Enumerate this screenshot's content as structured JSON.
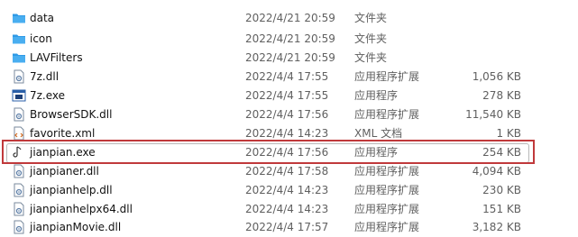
{
  "files": [
    {
      "icon": "folder-icon",
      "name": "data",
      "date": "2022/4/21 20:59",
      "type": "文件夹",
      "size": ""
    },
    {
      "icon": "folder-icon",
      "name": "icon",
      "date": "2022/4/21 20:59",
      "type": "文件夹",
      "size": ""
    },
    {
      "icon": "folder-icon",
      "name": "LAVFilters",
      "date": "2022/4/21 20:59",
      "type": "文件夹",
      "size": ""
    },
    {
      "icon": "dll-icon",
      "name": "7z.dll",
      "date": "2022/4/4 17:55",
      "type": "应用程序扩展",
      "size": "1,056 KB"
    },
    {
      "icon": "exe-icon",
      "name": "7z.exe",
      "date": "2022/4/4 17:55",
      "type": "应用程序",
      "size": "278 KB"
    },
    {
      "icon": "dll-icon",
      "name": "BrowserSDK.dll",
      "date": "2022/4/4 17:56",
      "type": "应用程序扩展",
      "size": "11,540 KB"
    },
    {
      "icon": "xml-icon",
      "name": "favorite.xml",
      "date": "2022/4/4 14:23",
      "type": "XML 文档",
      "size": "1 KB"
    },
    {
      "icon": "jianpian-exe-icon",
      "name": "jianpian.exe",
      "date": "2022/4/4 17:56",
      "type": "应用程序",
      "size": "254 KB"
    },
    {
      "icon": "dll-icon",
      "name": "jianpianer.dll",
      "date": "2022/4/4 17:58",
      "type": "应用程序扩展",
      "size": "4,094 KB"
    },
    {
      "icon": "dll-icon",
      "name": "jianpianhelp.dll",
      "date": "2022/4/4 14:23",
      "type": "应用程序扩展",
      "size": "230 KB"
    },
    {
      "icon": "dll-icon",
      "name": "jianpianhelpx64.dll",
      "date": "2022/4/4 14:23",
      "type": "应用程序扩展",
      "size": "151 KB"
    },
    {
      "icon": "dll-icon",
      "name": "jianpianMovie.dll",
      "date": "2022/4/4 17:57",
      "type": "应用程序扩展",
      "size": "3,182 KB"
    }
  ],
  "colors": {
    "folder": "#2f9ae6",
    "highlight": "#c0393b",
    "selection_border": "#b8b8b8"
  }
}
